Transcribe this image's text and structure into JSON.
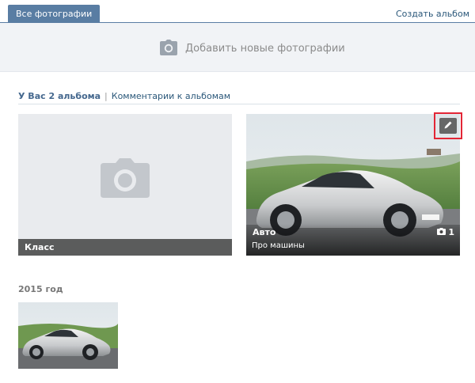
{
  "tabs": {
    "active_label": "Все фотографии",
    "create_album": "Создать альбом"
  },
  "upload": {
    "label": "Добавить новые фотографии",
    "icon": "camera-icon"
  },
  "summary": {
    "albums_count": "У Вас 2 альбома",
    "separator": "|",
    "comments": "Комментарии к альбомам"
  },
  "albums": [
    {
      "title": "Класс",
      "icon": "camera-placeholder-icon"
    },
    {
      "title": "Авто",
      "description": "Про машины",
      "count": "1",
      "count_icon": "camera-icon",
      "edit_icon": "pencil-icon"
    }
  ],
  "year_section": {
    "label": "2015 год"
  },
  "colors": {
    "accent": "#597da3",
    "link": "#2b587a",
    "highlight": "#e32636"
  }
}
